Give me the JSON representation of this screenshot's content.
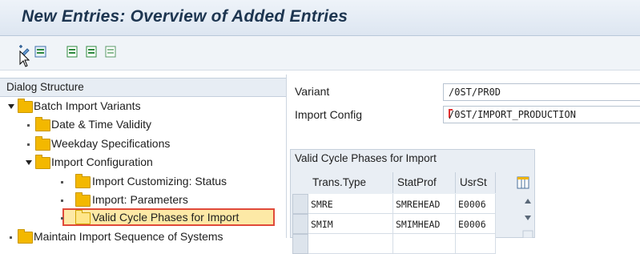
{
  "title": "New Entries: Overview of Added Entries",
  "toolbar": {
    "icons": [
      "display-change-icon",
      "save-entries-icon",
      "select-all-icon",
      "select-block-icon",
      "deselect-all-icon"
    ]
  },
  "dialog_structure": {
    "header": "Dialog Structure",
    "nodes": [
      {
        "label": "Batch Import Variants",
        "state": "expanded"
      },
      {
        "label": "Date & Time Validity",
        "state": "leaf"
      },
      {
        "label": "Weekday Specifications",
        "state": "leaf"
      },
      {
        "label": "Import Configuration",
        "state": "expanded"
      },
      {
        "label": "Import Customizing: Status",
        "state": "leaf"
      },
      {
        "label": "Import: Parameters",
        "state": "leaf"
      },
      {
        "label": "Valid Cycle Phases for Import",
        "state": "selected"
      },
      {
        "label": "Maintain Import Sequence of Systems",
        "state": "leaf"
      }
    ]
  },
  "fields": {
    "variant_label": "Variant",
    "variant_value": "/0ST/PR0D",
    "import_config_label": "Import Config",
    "import_config_value": "/0ST/IMPORT_PRODUCTION"
  },
  "table": {
    "title": "Valid Cycle Phases for Import",
    "columns": [
      "Trans.Type",
      "StatProf",
      "UsrSt"
    ],
    "rows": [
      [
        "SMRE",
        "SMREHEAD",
        "E0006"
      ],
      [
        "SMIM",
        "SMIMHEAD",
        "E0006"
      ]
    ]
  },
  "colors": {
    "highlight_border": "#e04a3a",
    "folder": "#f3b800",
    "title_text": "#1d3550"
  }
}
